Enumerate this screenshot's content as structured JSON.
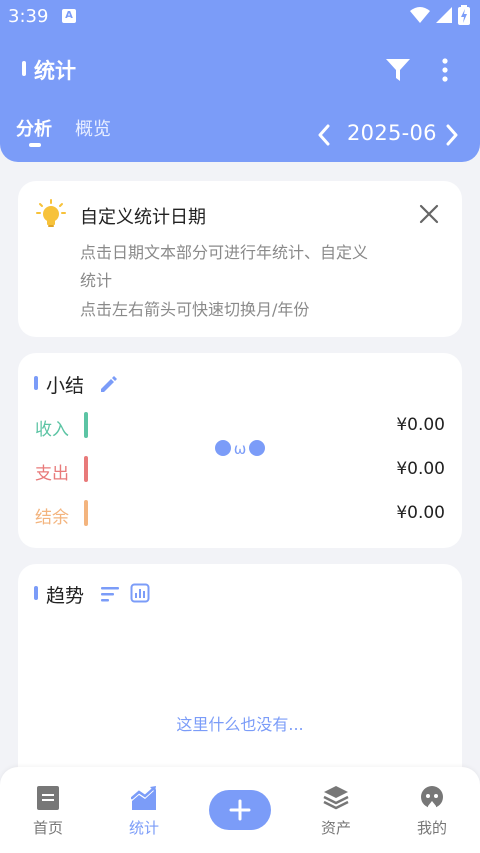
{
  "status_bar": {
    "time": "3:39",
    "notification_letter": "A"
  },
  "header": {
    "title": "统计",
    "tabs": [
      {
        "label": "分析",
        "active": true
      },
      {
        "label": "概览",
        "active": false
      }
    ],
    "month": "2025-06",
    "icons": {
      "filter": "filter-icon",
      "more": "more-vertical-icon",
      "prev": "chevron-left-icon",
      "next": "chevron-right-icon"
    }
  },
  "tip": {
    "title": "自定义统计日期",
    "line1": "点击日期文本部分可进行年统计、自定义",
    "line2": "统计",
    "line3": "点击左右箭头可快速切换月/年份",
    "icon": "lightbulb-icon"
  },
  "summary": {
    "title": "小结",
    "rows": [
      {
        "label": "收入",
        "value": "¥0.00",
        "color": "#5cc4a4"
      },
      {
        "label": "支出",
        "value": "¥0.00",
        "color": "#e87a7a"
      },
      {
        "label": "结余",
        "value": "¥0.00",
        "color": "#f3b47e"
      }
    ],
    "face_text": "ω"
  },
  "trend": {
    "title": "趋势",
    "empty_text": "这里什么也没有..."
  },
  "bottom_nav": {
    "items": [
      {
        "label": "首页",
        "icon": "home-document-icon",
        "active": false
      },
      {
        "label": "统计",
        "icon": "chart-icon",
        "active": true
      },
      {
        "label": "资产",
        "icon": "layers-icon",
        "active": false
      },
      {
        "label": "我的",
        "icon": "profile-icon",
        "active": false
      }
    ],
    "add_icon": "plus-icon"
  },
  "colors": {
    "accent": "#7b9cf8",
    "background": "#f2f3f7",
    "income": "#5cc4a4",
    "expense": "#e87a7a",
    "balance": "#f3b47e"
  }
}
